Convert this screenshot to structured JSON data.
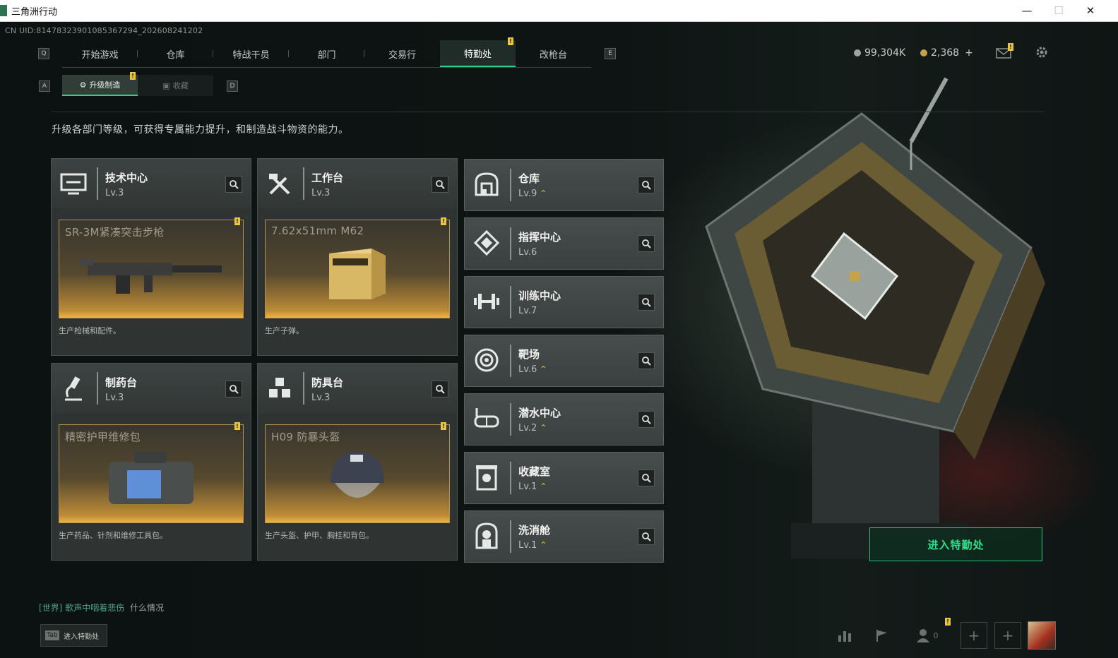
{
  "window": {
    "title": "三角洲行动",
    "minimize": "—",
    "maximize": "☐",
    "close": "✕"
  },
  "uid": "CN UID:81478323901085367294_202608241202",
  "keys": {
    "q": "Q",
    "e": "E",
    "a": "A",
    "d": "D"
  },
  "nav": {
    "tabs": [
      "开始游戏",
      "仓库",
      "特战干员",
      "部门",
      "交易行",
      "特勤处",
      "改枪台"
    ],
    "active": "特勤处"
  },
  "badge": "!",
  "currency": {
    "silver": "99,304K",
    "gold": "2,368",
    "plus": "+"
  },
  "subtabs": {
    "upgrade": "升级制造",
    "collect": "收藏"
  },
  "description": "升级各部门等级，可获得专属能力提升，和制造战斗物资的能力。",
  "big_cards": [
    {
      "name": "技术中心",
      "level": "Lv.3",
      "product": "SR-3M紧凑突击步枪",
      "desc": "生产枪械和配件。",
      "icon": "monitor-icon",
      "product_icon": "rifle-icon"
    },
    {
      "name": "工作台",
      "level": "Lv.3",
      "product": "7.62x51mm M62",
      "desc": "生产子弹。",
      "icon": "tools-icon",
      "product_icon": "ammo-box-icon"
    },
    {
      "name": "制药台",
      "level": "Lv.3",
      "product": "精密护甲维修包",
      "desc": "生产药品、针剂和维修工具包。",
      "icon": "microscope-icon",
      "product_icon": "repair-kit-icon"
    },
    {
      "name": "防具台",
      "level": "Lv.3",
      "product": "H09 防暴头盔",
      "desc": "生产头盔、护甲、胸挂和背包。",
      "icon": "cubes-icon",
      "product_icon": "helmet-icon"
    }
  ],
  "small_cards": [
    {
      "name": "仓库",
      "level": "Lv.9",
      "upgrade": true,
      "icon": "vault-icon"
    },
    {
      "name": "指挥中心",
      "level": "Lv.6",
      "upgrade": false,
      "icon": "chip-icon"
    },
    {
      "name": "训练中心",
      "level": "Lv.7",
      "upgrade": false,
      "icon": "dumbbell-icon"
    },
    {
      "name": "靶场",
      "level": "Lv.6",
      "upgrade": true,
      "icon": "target-icon"
    },
    {
      "name": "潜水中心",
      "level": "Lv.2",
      "upgrade": true,
      "icon": "dive-mask-icon"
    },
    {
      "name": "收藏室",
      "level": "Lv.1",
      "upgrade": true,
      "icon": "display-case-icon"
    },
    {
      "name": "洗消舱",
      "level": "Lv.1",
      "upgrade": true,
      "icon": "decon-icon"
    }
  ],
  "upgrade_glyph": "⌃",
  "enter_button": "进入特勤处",
  "chat": {
    "channel": "[世界]",
    "user": "歌声中咽着悲伤",
    "message": "什么情况"
  },
  "tab_hint": {
    "key": "Tab",
    "label": "进入特勤处"
  },
  "bottom": {
    "friends_count": "0",
    "plus": "+"
  },
  "accent": "#29d48a",
  "gold_color": "#e9c642"
}
